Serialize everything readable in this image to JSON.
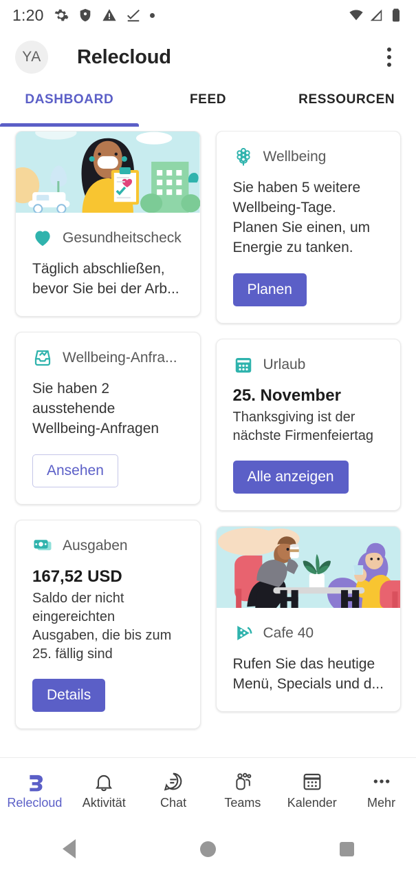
{
  "statusbar": {
    "time": "1:20",
    "left_icons": [
      "gear-icon",
      "shield-icon",
      "warning-icon",
      "checkmark-underline-icon",
      "dot-icon"
    ],
    "right_icons": [
      "wifi-icon",
      "cellular-signal-icon",
      "battery-icon"
    ]
  },
  "appbar": {
    "avatar_initials": "YA",
    "title": "Relecloud",
    "overflow_label": "Weitere Optionen"
  },
  "tabs": [
    {
      "label": "DASHBOARD",
      "active": true
    },
    {
      "label": "FEED",
      "active": false
    },
    {
      "label": "RESSOURCEN",
      "active": false
    }
  ],
  "cards": {
    "gesundheitscheck": {
      "icon": "heart-icon",
      "title": "Gesundheitscheck",
      "text": "Täglich abschließen, bevor Sie bei der Arb..."
    },
    "wellbeing": {
      "icon": "flower-icon",
      "title": "Wellbeing",
      "text": "Sie haben 5 weitere Wellbeing-Tage. Planen Sie einen, um Energie zu tanken.",
      "button": "Planen"
    },
    "wellbeing_anfragen": {
      "icon": "inbox-tray-icon",
      "title": "Wellbeing-Anfra...",
      "text": "Sie haben 2 ausstehende Wellbeing-Anfragen",
      "button": "Ansehen"
    },
    "urlaub": {
      "icon": "calendar-icon",
      "title": "Urlaub",
      "headline": "25. November",
      "text": "Thanksgiving ist der nächste Firmenfeiertag",
      "button": "Alle anzeigen"
    },
    "ausgaben": {
      "icon": "money-icon",
      "title": "Ausgaben",
      "amount": "167,52 USD",
      "text": "Saldo der nicht eingereichten Ausgaben, die bis zum 25. fällig sind",
      "button": "Details"
    },
    "cafe": {
      "icon": "pizza-icon",
      "title": "Cafe 40",
      "text": "Rufen Sie das heutige Menü, Specials und d..."
    }
  },
  "bottomnav": [
    {
      "label": "Relecloud",
      "icon": "relecloud-logo-icon",
      "active": true
    },
    {
      "label": "Aktivität",
      "icon": "bell-icon",
      "active": false
    },
    {
      "label": "Chat",
      "icon": "chat-bubble-icon",
      "active": false
    },
    {
      "label": "Teams",
      "icon": "teams-people-icon",
      "active": false
    },
    {
      "label": "Kalender",
      "icon": "calendar-icon",
      "active": false
    },
    {
      "label": "Mehr",
      "icon": "ellipsis-icon",
      "active": false
    }
  ],
  "androidnav": [
    {
      "label": "Zurück",
      "icon": "back-triangle-icon"
    },
    {
      "label": "Startseite",
      "icon": "home-circle-icon"
    },
    {
      "label": "Übersicht",
      "icon": "recents-square-icon"
    }
  ],
  "colors": {
    "accent_purple": "#5b5fc7",
    "icon_teal": "#2fb3ad",
    "illustration_bg": "#c5ecf0"
  }
}
